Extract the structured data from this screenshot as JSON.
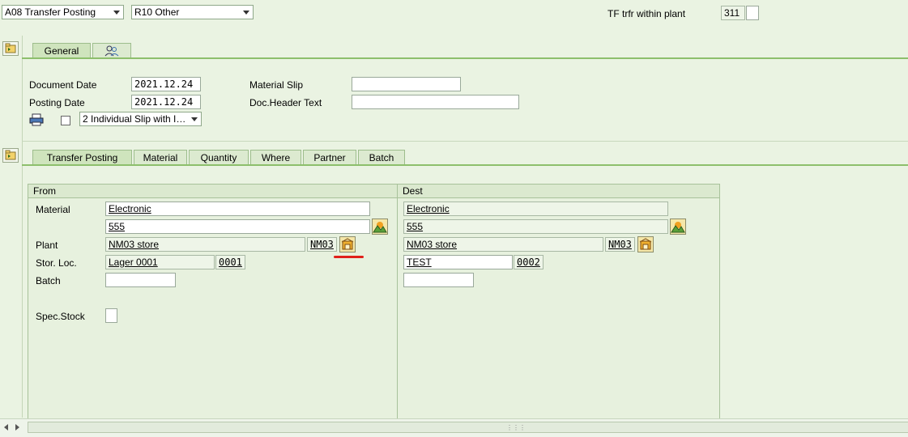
{
  "header": {
    "action_dropdown": "A08 Transfer Posting",
    "reference_dropdown": "R10 Other",
    "movement_label": "TF trfr within plant",
    "movement_type": "311",
    "movement_extra": ""
  },
  "header_tabs": {
    "general": "General"
  },
  "general": {
    "document_date_label": "Document Date",
    "document_date": "2021.12.24",
    "posting_date_label": "Posting Date",
    "posting_date": "2021.12.24",
    "material_slip_label": "Material Slip",
    "material_slip": "",
    "doc_header_text_label": "Doc.Header Text",
    "doc_header_text": "",
    "print_dropdown": "2 Individual Slip with I…"
  },
  "item_tabs": [
    "Transfer Posting",
    "Material",
    "Quantity",
    "Where",
    "Partner",
    "Batch"
  ],
  "from": {
    "title": "From",
    "material_label": "Material",
    "material": "Electronic",
    "material_number": "555",
    "plant_label": "Plant",
    "plant_name": "NM03 store",
    "plant_code": "NM03",
    "sloc_label": "Stor. Loc.",
    "sloc_name": "Lager 0001",
    "sloc_code": "0001",
    "batch_label": "Batch",
    "batch": "",
    "spec_stock_label": "Spec.Stock",
    "spec_stock": ""
  },
  "dest": {
    "title": "Dest",
    "material": "Electronic",
    "material_number": "555",
    "plant_name": "NM03 store",
    "plant_code": "NM03",
    "sloc_name": "TEST",
    "sloc_code": "0002",
    "batch": ""
  },
  "colors": {
    "background": "#eaf3e2",
    "tab_accent": "#8dbf6c",
    "highlight_underline": "#e0201a"
  }
}
